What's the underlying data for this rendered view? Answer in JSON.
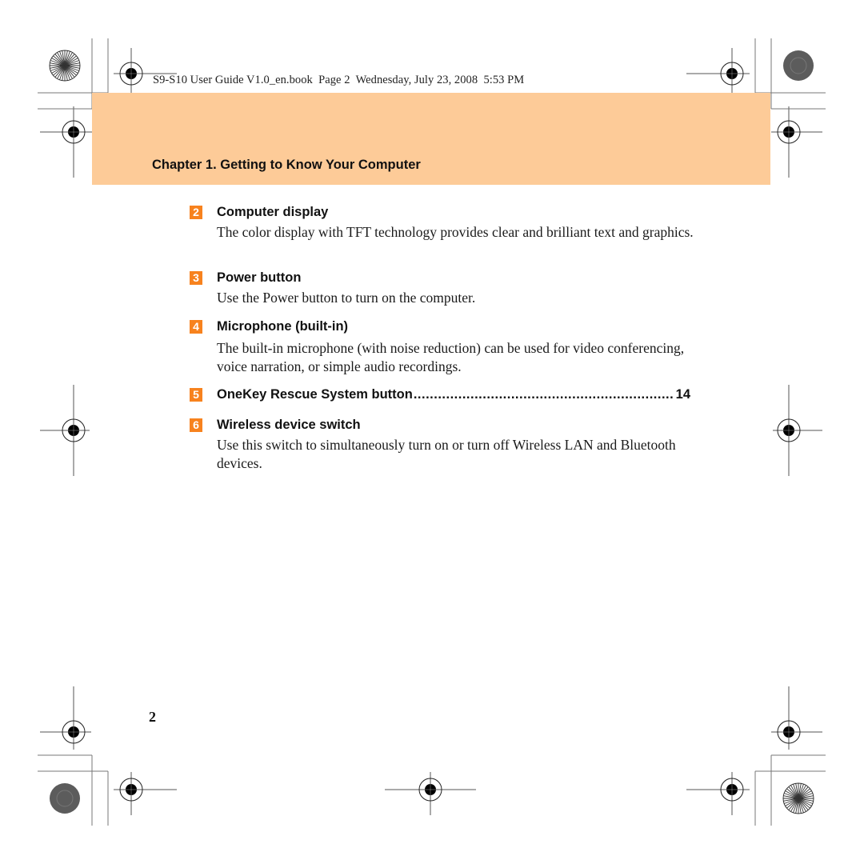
{
  "print_header": {
    "text": "S9-S10 User Guide V1.0_en.book  Page 2  Wednesday, July 23, 2008  5:53 PM"
  },
  "chapter": {
    "title": "Chapter 1. Getting to Know Your Computer",
    "band_color": "#fdcb98"
  },
  "accent_color": "#f7821e",
  "items": [
    {
      "number": "2",
      "title": "Computer display",
      "description": "The color display with TFT technology provides clear and brilliant text and graphics."
    },
    {
      "number": "3",
      "title": "Power button",
      "description": "Use the Power button to turn on the computer."
    },
    {
      "number": "4",
      "title": "Microphone (built-in)",
      "description": "The built-in microphone (with noise reduction) can be used for video conferencing, voice narration, or simple audio recordings."
    },
    {
      "number": "5",
      "title": "OneKey Rescue System button",
      "page_ref": "14"
    },
    {
      "number": "6",
      "title": "Wireless device switch",
      "description": "Use this switch to simultaneously turn on or turn off Wireless LAN and Bluetooth devices."
    }
  ],
  "page_number": "2",
  "print_marks": {
    "registration_mark_icon": "crosshair-target-icon",
    "color_bar_star_icon": "starburst-circle-icon",
    "color_bar_dark_icon": "gray-dot-circle-icon"
  }
}
